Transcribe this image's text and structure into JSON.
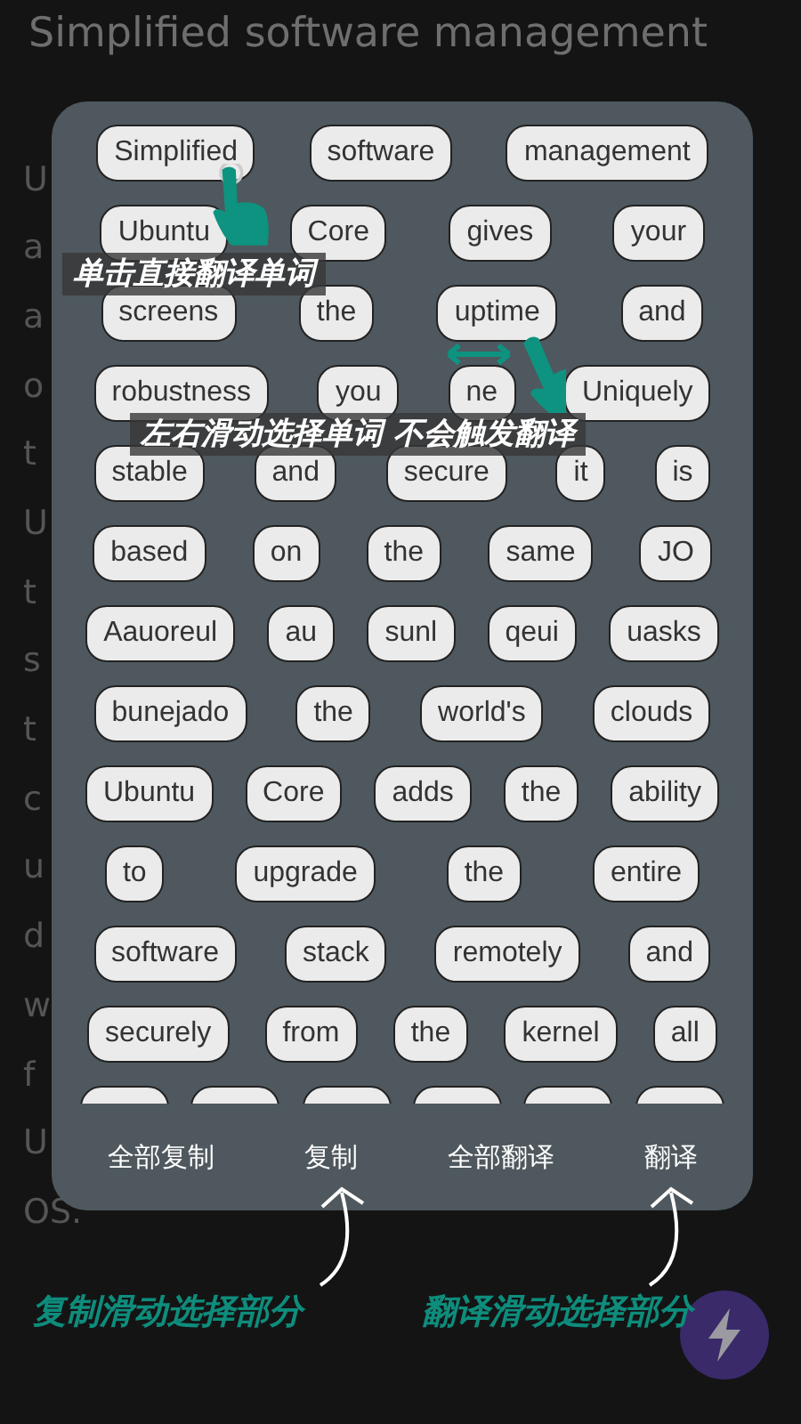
{
  "title": "Simplified software management",
  "background_lines": [
    "U",
    "a",
    "a",
    "o",
    "t",
    "U",
    "t",
    "s",
    "t",
    "c",
    "u",
    "d",
    "w",
    "f",
    "U",
    "OS."
  ],
  "panel": {
    "chip_rows": [
      [
        "Simplified",
        "software",
        "management"
      ],
      [
        "Ubuntu",
        "Core",
        "gives",
        "your"
      ],
      [
        "screens",
        "the",
        "uptime",
        "and"
      ],
      [
        "robustness",
        "you",
        "ne",
        "Uniquely"
      ],
      [
        "stable",
        "and",
        "secure",
        "it",
        "is"
      ],
      [
        "based",
        "on",
        "the",
        "same",
        "JO"
      ],
      [
        "Aauoreul",
        "au",
        "sunl",
        "qeui",
        "uasks"
      ],
      [
        "bunejado",
        "the",
        "world's",
        "clouds"
      ],
      [
        "Ubuntu",
        "Core",
        "adds",
        "the",
        "ability"
      ],
      [
        "to",
        "upgrade",
        "the",
        "entire"
      ],
      [
        "software",
        "stack",
        "remotely",
        "and"
      ],
      [
        "securely",
        "from",
        "the",
        "kernel",
        "all"
      ]
    ],
    "actions": [
      "全部复制",
      "复制",
      "全部翻译",
      "翻译"
    ]
  },
  "hints": [
    "单击直接翻译单词",
    "左右滑动选择单词 不会触发翻译"
  ],
  "captions": [
    "复制滑动选择部分",
    "翻译滑动选择部分"
  ]
}
